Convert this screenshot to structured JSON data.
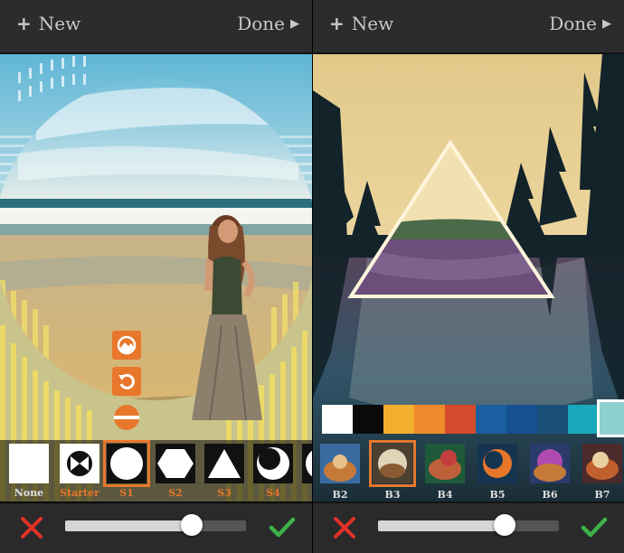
{
  "left_screen": {
    "new_label": "New",
    "done_label": "Done",
    "shapes": [
      {
        "label": "None",
        "orange": false,
        "icon": "blank-square"
      },
      {
        "label": "Starter",
        "orange": true,
        "icon": "starter-circle"
      },
      {
        "label": "S1",
        "orange": true,
        "icon": "circle",
        "selected": true
      },
      {
        "label": "S2",
        "orange": true,
        "icon": "hexagon"
      },
      {
        "label": "S3",
        "orange": true,
        "icon": "triangle"
      },
      {
        "label": "S4",
        "orange": true,
        "icon": "crescent"
      }
    ],
    "slider_value": 0.7
  },
  "right_screen": {
    "new_label": "New",
    "done_label": "Done",
    "colors": [
      "#ffffff",
      "#0a0a0a",
      "#f2ae2e",
      "#ef8a2c",
      "#d44a2c",
      "#1a5fa0",
      "#155090",
      "#1a4f78",
      "#19a9bd",
      "#8fd0d0"
    ],
    "selected_color_index": 9,
    "blends": [
      {
        "label": "B2",
        "orange": false
      },
      {
        "label": "B3",
        "orange": false,
        "selected": true
      },
      {
        "label": "B4",
        "orange": false
      },
      {
        "label": "B5",
        "orange": false
      },
      {
        "label": "B6",
        "orange": false
      },
      {
        "label": "B7",
        "orange": false
      }
    ],
    "slider_value": 0.7
  },
  "accent_color": "#e8772b",
  "cancel_color": "#e0322a",
  "confirm_color": "#3fb24a"
}
